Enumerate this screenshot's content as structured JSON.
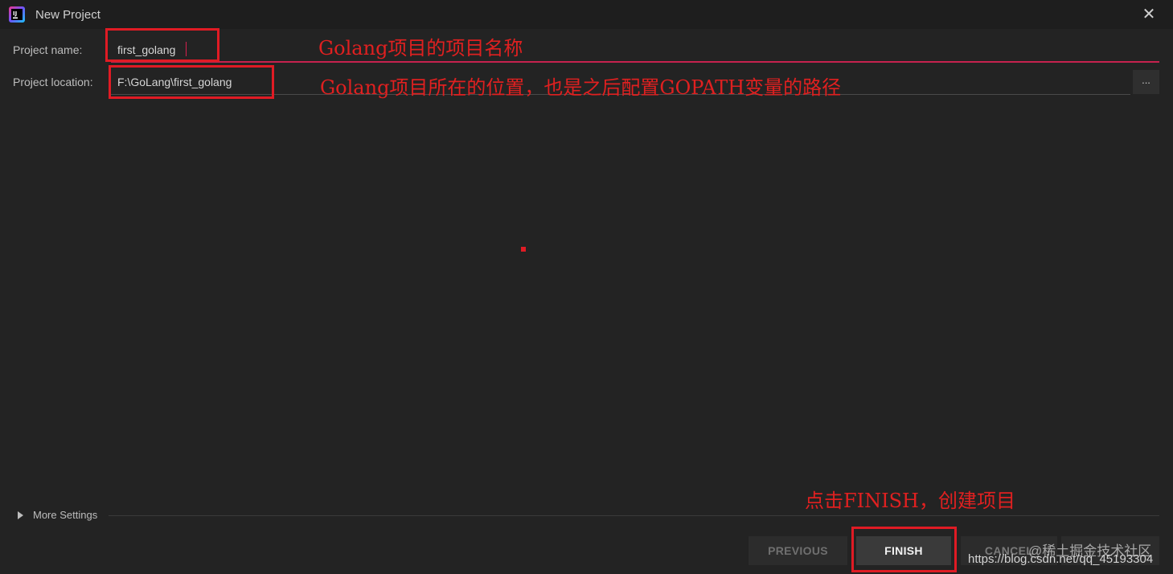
{
  "window": {
    "title": "New Project",
    "close_glyph": "✕"
  },
  "form": {
    "name_label": "Project name:",
    "name_value": "first_golang",
    "location_label": "Project location:",
    "location_value": "F:\\GoLang\\first_golang",
    "browse_label": "..."
  },
  "annotations": {
    "name_note": "Golang项目的项目名称",
    "location_note": "Golang项目所在的位置，也是之后配置GOPATH变量的路径",
    "finish_note": "点击FINISH，创建项目"
  },
  "more_settings": {
    "label": "More Settings"
  },
  "buttons": {
    "previous": "PREVIOUS",
    "finish": "FINISH",
    "cancel": "CANCEL"
  },
  "watermark": {
    "community": "@稀土掘金技术社区",
    "url": "https://blog.csdn.net/qq_45193304"
  },
  "colors": {
    "accent": "#c6224e",
    "annotation_red": "#e01b24",
    "background": "#232323"
  },
  "icons": {
    "app": "jetbrains-goland-icon",
    "close": "close-icon",
    "expand": "triangle-right-icon"
  }
}
